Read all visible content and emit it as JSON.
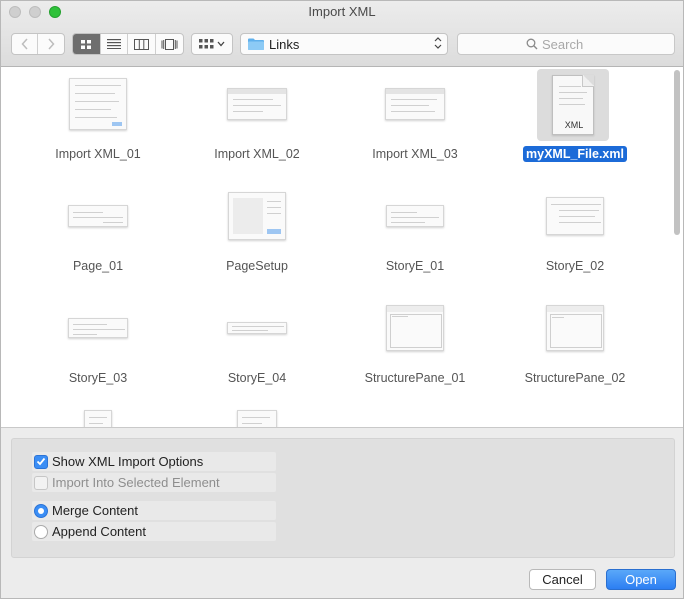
{
  "window": {
    "title": "Import XML"
  },
  "toolbar": {
    "back_icon": "chevron-left-icon",
    "forward_icon": "chevron-right-icon",
    "view_modes": [
      "icon-view",
      "list-view",
      "column-view",
      "cover-flow-view"
    ],
    "active_view": "icon-view",
    "arrange_icon": "grid-arrange-icon",
    "location": "Links",
    "search_placeholder": "Search"
  },
  "files": [
    {
      "name": "Import XML_01"
    },
    {
      "name": "Import XML_02"
    },
    {
      "name": "Import XML_03"
    },
    {
      "name": "myXML_File.xml",
      "selected": true,
      "badge": "XML"
    },
    {
      "name": "Page_01"
    },
    {
      "name": "PageSetup"
    },
    {
      "name": "StoryE_01"
    },
    {
      "name": "StoryE_02"
    },
    {
      "name": "StoryE_03"
    },
    {
      "name": "StoryE_04"
    },
    {
      "name": "StructurePane_01"
    },
    {
      "name": "StructurePane_02"
    }
  ],
  "options": {
    "show_import_options": {
      "label": "Show XML Import Options",
      "checked": true
    },
    "import_into_selected": {
      "label": "Import Into Selected Element",
      "checked": false,
      "enabled": false
    },
    "merge_content": {
      "label": "Merge Content",
      "selected": true
    },
    "append_content": {
      "label": "Append Content",
      "selected": false
    }
  },
  "buttons": {
    "cancel": "Cancel",
    "open": "Open"
  },
  "colors": {
    "accent": "#1c6bd8",
    "primary_button": "#2c7ef2",
    "close_zoom_green": "#2fc13a"
  }
}
